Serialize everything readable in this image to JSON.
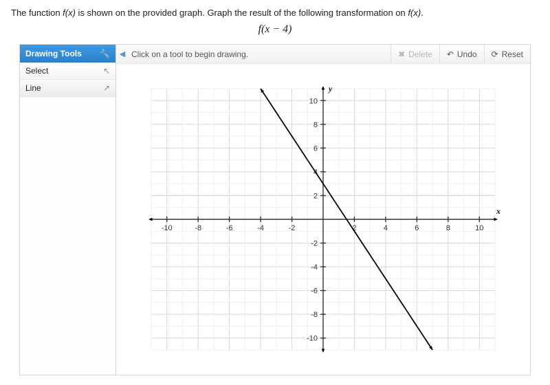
{
  "prompt_prefix": "The function ",
  "prompt_fx1": "f(x)",
  "prompt_mid": " is shown on the provided graph. Graph the result of the following transformation on ",
  "prompt_fx2": "f(x)",
  "prompt_suffix": ".",
  "formula": "f(x − 4)",
  "tools": {
    "header": "Drawing Tools",
    "items": [
      {
        "label": "Select",
        "icon": "↖"
      },
      {
        "label": "Line",
        "icon": "↗"
      }
    ]
  },
  "topbar": {
    "collapse": "◀",
    "hint": "Click on a tool to begin drawing.",
    "delete": {
      "label": "Delete",
      "icon": "✖"
    },
    "undo": {
      "label": "Undo",
      "icon": "↶"
    },
    "reset": {
      "label": "Reset",
      "icon": "⟳"
    }
  },
  "chart_data": {
    "type": "line",
    "title": "",
    "xlabel": "x",
    "ylabel": "y",
    "xlim": [
      -11,
      11
    ],
    "ylim": [
      -11,
      11
    ],
    "x_ticks": [
      -10,
      -8,
      -6,
      -4,
      -2,
      2,
      4,
      6,
      8,
      10
    ],
    "y_ticks": [
      -10,
      -8,
      -6,
      -4,
      -2,
      2,
      4,
      6,
      8,
      10
    ],
    "grid": true,
    "series": [
      {
        "name": "f(x)",
        "points": [
          [
            -4,
            11
          ],
          [
            7,
            -11
          ]
        ],
        "style": "solid-arrows"
      }
    ]
  }
}
